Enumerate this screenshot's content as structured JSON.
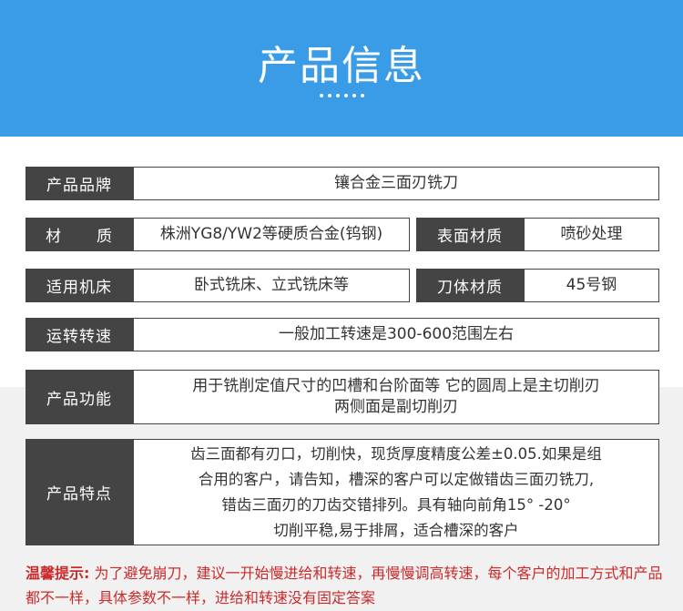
{
  "banner": {
    "title": "产品信息"
  },
  "rows": {
    "brand": {
      "label": "产品品牌",
      "value": "镶合金三面刃铣刀"
    },
    "material": {
      "label_a": "材",
      "label_b": "质",
      "value": "株洲YG8/YW2等硬质合金(钨钢)"
    },
    "surface": {
      "label": "表面材质",
      "value": "喷砂处理"
    },
    "machine": {
      "label": "适用机床",
      "value": "卧式铣床、立式铣床等"
    },
    "body_material": {
      "label": "刀体材质",
      "value": "45号钢"
    },
    "speed": {
      "label": "运转转速",
      "value": "一般加工转速是300-600范围左右"
    },
    "function": {
      "label": "产品功能",
      "line1": "用于铣削定值尺寸的凹槽和台阶面等 它的圆周上是主切削刃",
      "line2": "两侧面是副切削刃"
    },
    "features": {
      "label": "产品特点",
      "line1": "齿三面都有刃口，切削快，现货厚度精度公差±0.05.如果是组",
      "line2": "合用的客户，请告知，槽深的客户可以定做错齿三面刃铣刀,",
      "line3": "错齿三面刃的刀齿交错排列。具有轴向前角15° -20°",
      "line4": "切削平稳,易于排屑，适合槽深的客户"
    }
  },
  "notice": {
    "prefix": "温馨提示:",
    "text": "为了避免崩刀，建议一开始慢进给和转速，再慢慢调高转速，每个客户的加工方式和产品都不一样，具体参数不一样，进给和转速没有固定答案"
  },
  "colors": {
    "banner": "#3a9ce6",
    "label_bg": "#444444",
    "notice": "#cc2a2a",
    "band": "#f1f1f1"
  }
}
